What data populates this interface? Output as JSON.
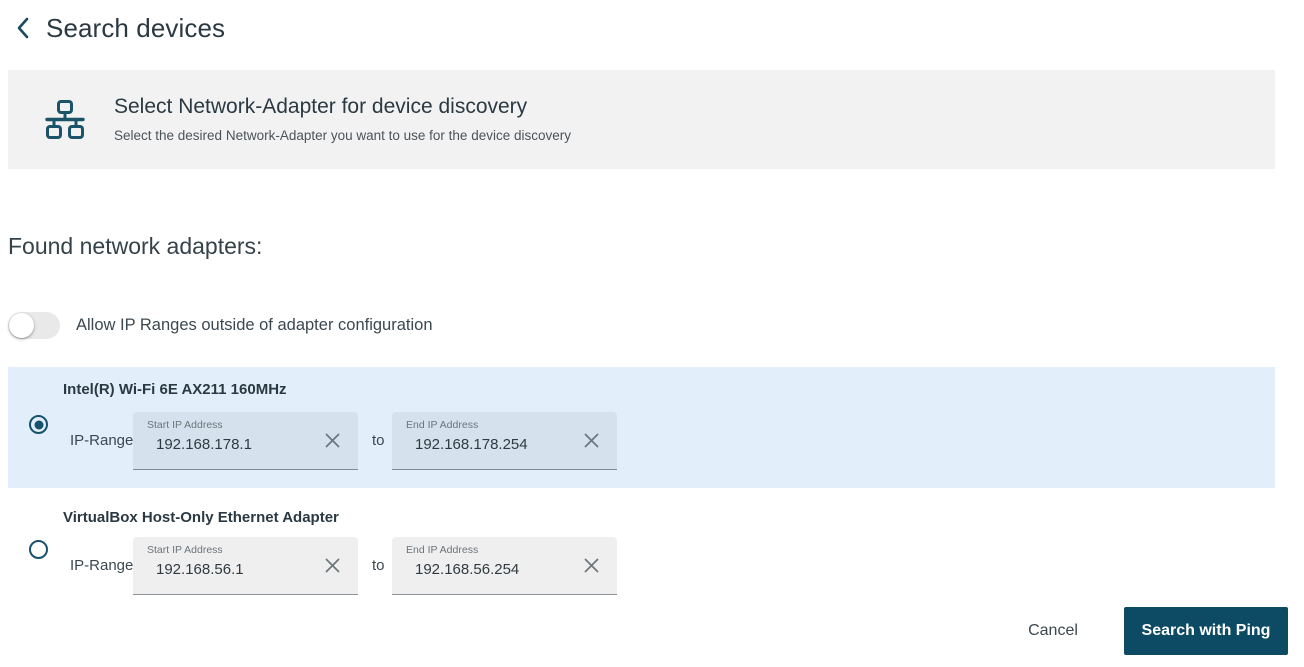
{
  "header": {
    "back_icon": "chevron-left-icon",
    "title": "Search devices"
  },
  "banner": {
    "icon": "sitemap-icon",
    "title": "Select Network-Adapter for device discovery",
    "subtitle": "Select the desired Network-Adapter you want to use for the device discovery",
    "background": "#f2f2f3"
  },
  "section": {
    "heading": "Found network adapters:"
  },
  "toggle": {
    "label": "Allow IP Ranges outside of adapter configuration",
    "state": "off"
  },
  "adapters": [
    {
      "name": "Intel(R) Wi-Fi 6E AX211 160MHz",
      "selected": true,
      "range_label": "IP-Range:",
      "separator": "to",
      "start": {
        "label": "Start IP Address",
        "value": "192.168.178.1",
        "clear_icon": "close-icon"
      },
      "end": {
        "label": "End IP Address",
        "value": "192.168.178.254",
        "clear_icon": "close-icon"
      }
    },
    {
      "name": "VirtualBox Host-Only Ethernet Adapter",
      "selected": false,
      "range_label": "IP-Range:",
      "separator": "to",
      "start": {
        "label": "Start IP Address",
        "value": "192.168.56.1",
        "clear_icon": "close-icon"
      },
      "end": {
        "label": "End IP Address",
        "value": "192.168.56.254",
        "clear_icon": "close-icon"
      }
    }
  ],
  "footer": {
    "cancel_label": "Cancel",
    "primary_label": "Search with Ping"
  },
  "colors": {
    "accent": "#16526b",
    "primary_button": "#0d4a63",
    "selected_row": "#e2effa",
    "banner_bg": "#f2f2f3"
  }
}
